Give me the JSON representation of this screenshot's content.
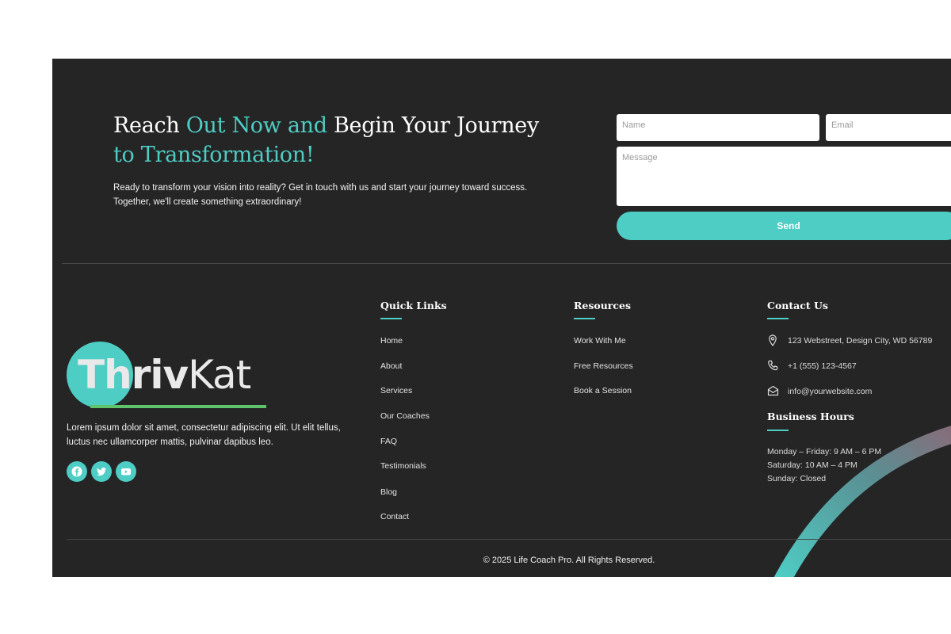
{
  "cta": {
    "title_part1": "Reach ",
    "title_part2": "Out Now and",
    "title_part3": " Begin Your Journey",
    "title_part4": "to Transformation!",
    "text_line1": "Ready to transform your vision into reality? Get in touch with us and start your journey toward success.",
    "text_line2": "Together, we'll create something extraordinary!"
  },
  "form": {
    "name_placeholder": "Name",
    "email_placeholder": "Email",
    "message_placeholder": "Message",
    "send_label": "Send"
  },
  "brand": {
    "logo_part1": "Thriv",
    "logo_part2": "Kat",
    "description_line1": "Lorem ipsum dolor sit amet, consectetur adipiscing elit. Ut elit tellus,",
    "description_line2": "luctus nec ullamcorper mattis, pulvinar dapibus leo.",
    "social_icons": [
      "facebook-icon",
      "twitter-icon",
      "youtube-icon"
    ]
  },
  "quick_links": {
    "title": "Quick Links",
    "items": [
      "Home",
      "About",
      "Services",
      "Our Coaches",
      "FAQ",
      "Testimonials",
      "Blog",
      "Contact"
    ]
  },
  "resources": {
    "title": "Resources",
    "items": [
      "Work With Me",
      "Free Resources",
      "Book a Session"
    ]
  },
  "contact": {
    "title": "Contact Us",
    "address": "123 Webstreet, Design City, WD 56789",
    "phone": "+1 (555) 123-4567",
    "email": "info@yourwebsite.com"
  },
  "hours": {
    "title": "Business Hours",
    "lines": [
      "Monday – Friday: 9 AM – 6 PM",
      "Saturday: 10 AM – 4 PM",
      "Sunday: Closed"
    ]
  },
  "footer": {
    "copyright": "© 2025 Life Coach Pro. All Rights Reserved."
  },
  "colors": {
    "background": "#252525",
    "accent": "#4ecdc4",
    "logo_underline": "#5ec36a"
  }
}
